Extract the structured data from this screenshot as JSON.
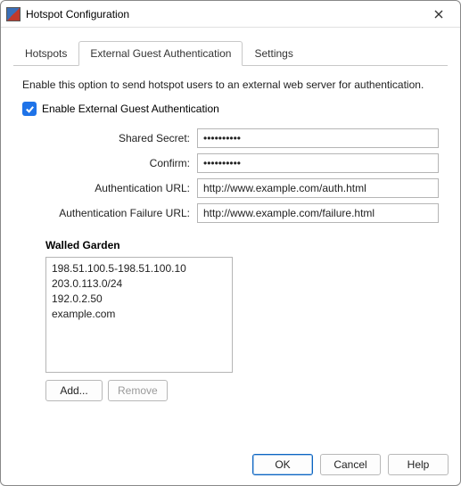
{
  "window": {
    "title": "Hotspot Configuration"
  },
  "tabs": {
    "hotspots": "Hotspots",
    "external_auth": "External Guest Authentication",
    "settings": "Settings"
  },
  "panel": {
    "instruction": "Enable this option to send hotspot users to an external web server for authentication.",
    "enable_label": "Enable External Guest Authentication",
    "fields": {
      "shared_secret_label": "Shared Secret:",
      "shared_secret_value": "••••••••••",
      "confirm_label": "Confirm:",
      "confirm_value": "••••••••••",
      "auth_url_label": "Authentication URL:",
      "auth_url_value": "http://www.example.com/auth.html",
      "fail_url_label": "Authentication Failure URL:",
      "fail_url_value": "http://www.example.com/failure.html"
    },
    "walled_garden": {
      "header": "Walled Garden",
      "items": [
        "198.51.100.5-198.51.100.10",
        "203.0.113.0/24",
        "192.0.2.50",
        "example.com"
      ],
      "add_label": "Add...",
      "remove_label": "Remove"
    }
  },
  "footer": {
    "ok": "OK",
    "cancel": "Cancel",
    "help": "Help"
  }
}
